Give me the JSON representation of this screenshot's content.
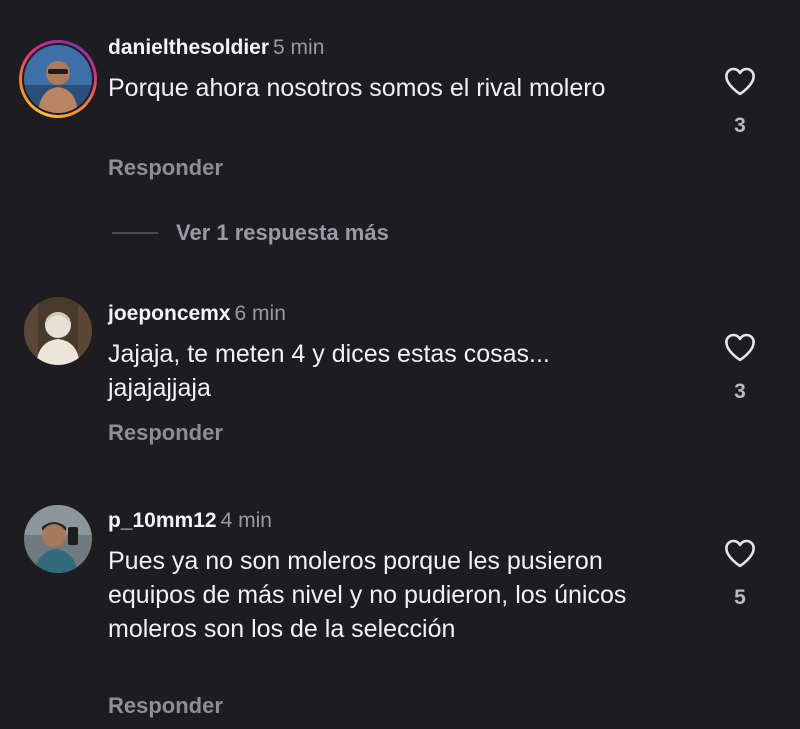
{
  "comments": [
    {
      "username": "danielthesoldier",
      "time": "5 min",
      "text": "Porque ahora nosotros somos el rival molero",
      "reply_label": "Responder",
      "likes": "3",
      "avatar_icon": "avatar-daniel-photo",
      "has_story_ring": true
    },
    {
      "username": "joeponcemx",
      "time": "6 min",
      "text": "Jajaja, te meten 4 y dices estas cosas... jajajajjaja",
      "reply_label": "Responder",
      "likes": "3",
      "avatar_icon": "avatar-statue-bust"
    },
    {
      "username": "p_10mm12",
      "time": "4 min",
      "text": "Pues ya no son moleros porque les pusieron equipos de más nivel y no pudieron, los únicos moleros son los de la selección",
      "reply_label": "Responder",
      "likes": "5",
      "avatar_icon": "avatar-selfie-photo"
    }
  ],
  "view_replies": {
    "label": "Ver 1 respuesta más"
  },
  "colors": {
    "background": "#1c1c21",
    "text": "#f2f2f2",
    "muted": "#9a9aa2",
    "story_ring": [
      "#f9c33a",
      "#f58529",
      "#dd2a7b",
      "#8134af"
    ]
  }
}
